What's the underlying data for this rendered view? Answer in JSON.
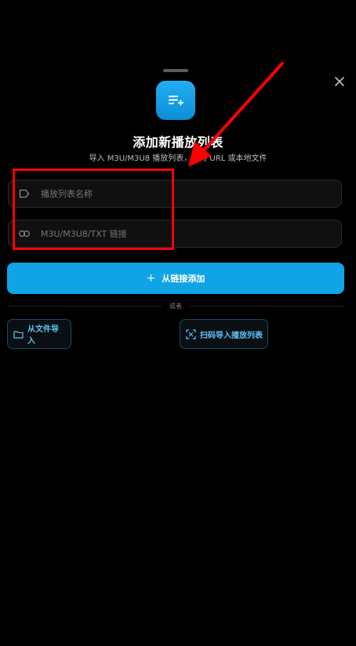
{
  "sheet": {
    "title": "添加新播放列表",
    "subtitle": "导入 M3U/M3U8 播放列表，支持 URL 或本地文件"
  },
  "icons": {
    "close": "close-icon",
    "app": "playlist-add-icon",
    "name_field": "tag-icon",
    "url_field": "link-icon",
    "primary": "plus-icon",
    "file": "folder-icon",
    "scan": "qr-scan-icon"
  },
  "form": {
    "name_placeholder": "播放列表名称",
    "url_placeholder": "M3U/M3U8/TXT 链接"
  },
  "actions": {
    "add_from_link": "从链接添加",
    "add_plus": "+",
    "or": "或者",
    "import_file": "从文件导入",
    "scan_import": "扫码导入播放列表"
  },
  "colors": {
    "background": "#000000",
    "accent": "#10a3e6",
    "outline_text": "#5bc4f5",
    "annotation": "#ff0000"
  }
}
